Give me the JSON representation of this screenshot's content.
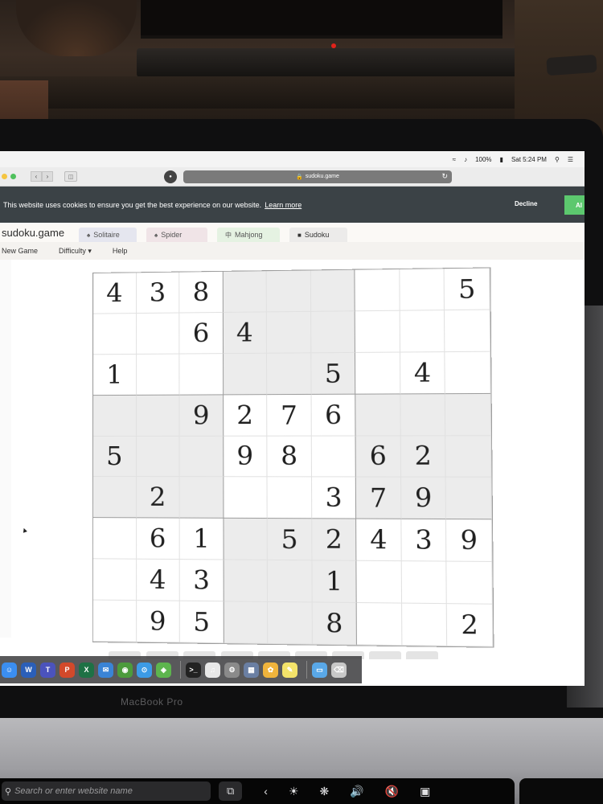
{
  "menubar": {
    "battery": "100%",
    "clock": "Sat 5:24 PM"
  },
  "browser": {
    "url": "sudoku.game"
  },
  "cookie_banner": {
    "message": "This website uses cookies to ensure you get the best experience on our website.",
    "learn_more": "Learn more",
    "decline": "Decline",
    "allow_partial": "Al"
  },
  "site": {
    "brand": "sudoku.game",
    "tabs": [
      "Solitaire",
      "Spider",
      "Mahjong",
      "Sudoku"
    ],
    "menu": [
      "New Game",
      "Difficulty",
      "Help"
    ]
  },
  "board": {
    "rows": [
      [
        "4",
        "3",
        "8",
        "",
        "",
        "",
        "",
        "",
        "5"
      ],
      [
        "",
        "",
        "6",
        "4",
        "",
        "",
        "",
        "",
        ""
      ],
      [
        "1",
        "",
        "",
        "",
        "",
        "5",
        "",
        "4",
        ""
      ],
      [
        "",
        "",
        "9",
        "2",
        "7",
        "6",
        "",
        "",
        ""
      ],
      [
        "5",
        "",
        "",
        "9",
        "8",
        "",
        "6",
        "2",
        ""
      ],
      [
        "",
        "2",
        "",
        "",
        "",
        "3",
        "7",
        "9",
        ""
      ],
      [
        "",
        "6",
        "1",
        "",
        "5",
        "2",
        "4",
        "3",
        "9"
      ],
      [
        "",
        "4",
        "3",
        "",
        "",
        "1",
        "",
        "",
        ""
      ],
      [
        "",
        "9",
        "5",
        "",
        "",
        "8",
        "",
        "",
        "2"
      ]
    ],
    "shaded_boxes": [
      1,
      3,
      5,
      7
    ]
  },
  "laptop": {
    "model": "MacBook Pro"
  },
  "touchbar": {
    "search_placeholder": "Search or enter website name"
  },
  "dock": {
    "icons": [
      "finder-icon",
      "word-icon",
      "teams-icon",
      "powerpoint-icon",
      "excel-icon",
      "mail-icon",
      "chrome-icon",
      "safari-icon",
      "maps-icon",
      "terminal-icon",
      "itunes-icon",
      "system-preferences-icon",
      "preview-icon",
      "photos-icon",
      "notes-icon",
      "folder-icon",
      "trash-icon"
    ]
  },
  "colors": {
    "cookie_bg": "#3b4246",
    "allow_green": "#5cc86e",
    "cell_shade": "#ececec"
  }
}
